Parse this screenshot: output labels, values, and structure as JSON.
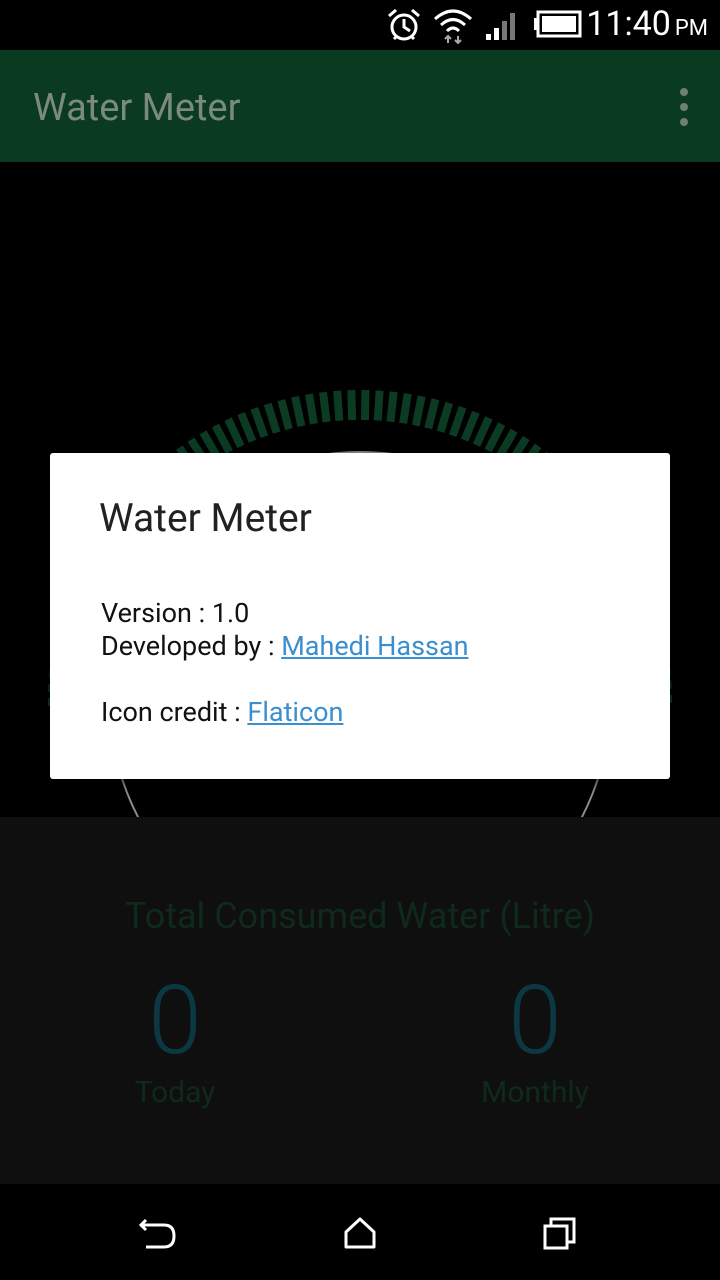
{
  "status_bar": {
    "time": "11:40",
    "ampm": "PM",
    "icons": [
      "alarm-icon",
      "wifi-icon",
      "signal-icon",
      "battery-icon"
    ]
  },
  "app_bar": {
    "title": "Water Meter",
    "menu_icon": "overflow-menu-icon"
  },
  "gauge": {
    "accent_color": "#0c3b23"
  },
  "bottom_panel": {
    "total_label": "Total Consumed Water (Litre)",
    "today_value": "0",
    "today_label": "Today",
    "monthly_value": "0",
    "monthly_label": "Monthly"
  },
  "dialog": {
    "title": "Water Meter",
    "version_text": "Version : 1.0",
    "developed_by_prefix": "Developed by : ",
    "developer_link": "Mahedi Hassan",
    "icon_credit_prefix": "Icon credit : ",
    "icon_credit_link": "Flaticon",
    "link_color": "#3a8fd0"
  },
  "nav_bar": {
    "buttons": [
      "back-icon",
      "home-icon",
      "recents-icon"
    ]
  }
}
